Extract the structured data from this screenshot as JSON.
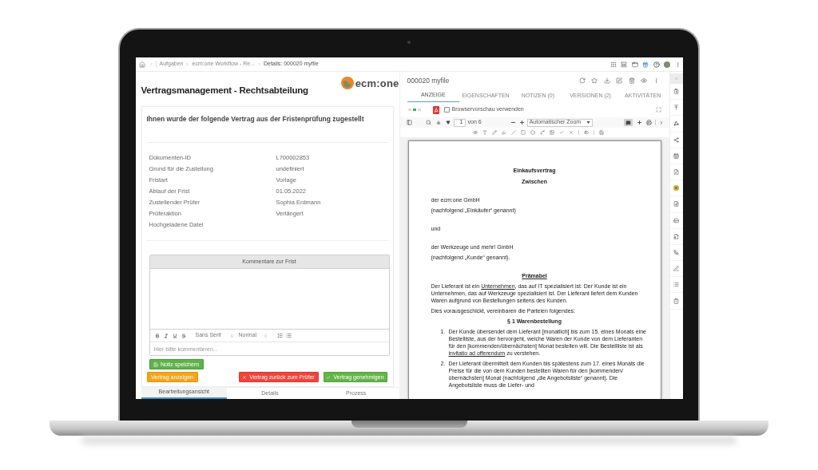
{
  "breadcrumb": [
    "Aufgaben",
    "ecm:one Workflow - Re...",
    "Details: 000020 myfile"
  ],
  "form": {
    "title": "Vertragsmanagement - Rechtsabteilung",
    "logo": "ecm:one",
    "heading": "Ihnen wurde der folgende Vertrag aus der Fristenprüfung zugestellt",
    "fields": [
      {
        "label": "Dokumenten-ID",
        "value": "L700002853"
      },
      {
        "label": "Grund für die Zustellung",
        "value": "undefiniert"
      },
      {
        "label": "Fristart",
        "value": "Vorlage"
      },
      {
        "label": "Ablauf der Frist",
        "value": "01.05.2022"
      },
      {
        "label": "Zustellender Prüfer",
        "value": "Sophia Erdmann"
      },
      {
        "label": "Prüferaktion",
        "value": "Verlängert"
      },
      {
        "label": "Hochgeladene Datei"
      }
    ],
    "comments": {
      "title": "Kommentare zur Frist",
      "font": "Sans Serif",
      "size": "Normal",
      "placeholder": "Hier bitte kommentieren..."
    },
    "save_button": {
      "kind": "save",
      "label": "Notiz speichern"
    },
    "actions": [
      {
        "kind": "show",
        "label": "Vertrag anzeigen"
      },
      {
        "kind": "reject",
        "label": "Vertrag zurück zum Prüfer"
      },
      {
        "kind": "approve",
        "label": "Vertrag genehmigen"
      }
    ]
  },
  "view_tabs": [
    {
      "label": "Bearbeitungsansicht",
      "selected": true
    },
    {
      "label": "Details",
      "selected": false
    },
    {
      "label": "Prozess",
      "selected": false
    }
  ],
  "document": {
    "title": "000020 myfile",
    "tabs": [
      {
        "label": "ANZEIGE",
        "selected": true
      },
      {
        "label": "EIGENSCHAFTEN",
        "selected": false
      },
      {
        "label": "NOTIZEN (0)",
        "selected": false
      },
      {
        "label": "VERSIONEN (2)",
        "selected": false
      },
      {
        "label": "AKTIVITÄTEN",
        "selected": false
      }
    ],
    "browser_preview": {
      "label": "Browservorschau verwenden",
      "checked": false
    },
    "toolbar": {
      "page": "1",
      "page_count": "von 6",
      "zoom": "Automatischer Zoom"
    },
    "page": {
      "title": "Einkaufsvertrag",
      "subtitle": "Zwischen",
      "parties": [
        {
          "name": "der ecm:one GmbH",
          "note": "(nachfolgend „Einkäufer“ genannt)"
        },
        {
          "name": "der Werkzeuge und mehr! GmbH",
          "note": "(nachfolgend „Kunde“ genannt)."
        }
      ],
      "conjunction": "und",
      "preamble_heading": "Prämabel",
      "preamble": [
        {
          "text": "Der Lieferant ist ein ",
          "underlined": false
        },
        {
          "text": "Unternehmen",
          "underlined": true
        },
        {
          "text": ", das auf IT spezialisiert ist. Der Kunde ist ein Unternehmen, das auf Werkzeuge spezialisiert ist. Der Lieferant liefert dem Kunden Waren aufgrund von Bestellungen seitens des Kunden.",
          "underlined": false
        }
      ],
      "closing": "Dies vorausgeschickt, vereinbaren die Parteien folgendes:",
      "section": {
        "title": "§ 1 Warenbestellung",
        "items": [
          {
            "number": "1.",
            "segments": [
              {
                "text": "Der Kunde übersendet dem Lieferant [monatlich] bis zum 15. eines Monats eine Bestelliste, aus der hervorgeht, welche Waren der Kunde von dem Lieferanten für den [kommenden/übernächsten] Monat bestellen will. Die Bestellliste ist als ",
                "underlined": false
              },
              {
                "text": "invitatio ad offerendum",
                "underlined": true
              },
              {
                "text": " zu verstehen.",
                "underlined": false
              }
            ]
          },
          {
            "number": "2.",
            "segments": [
              {
                "text": "Der Lieferant übermittelt dem Kunden bis spätestens zum 17. eines Monats die Preise für die von dem Kunden bestellten Waren für den [kommenden/übernächsten] Monat (nachfolgend „die Angebotsliste“ genannt). Die Angebotsliste muss die Liefer- und",
                "underlined": false
              }
            ]
          }
        ]
      }
    }
  }
}
